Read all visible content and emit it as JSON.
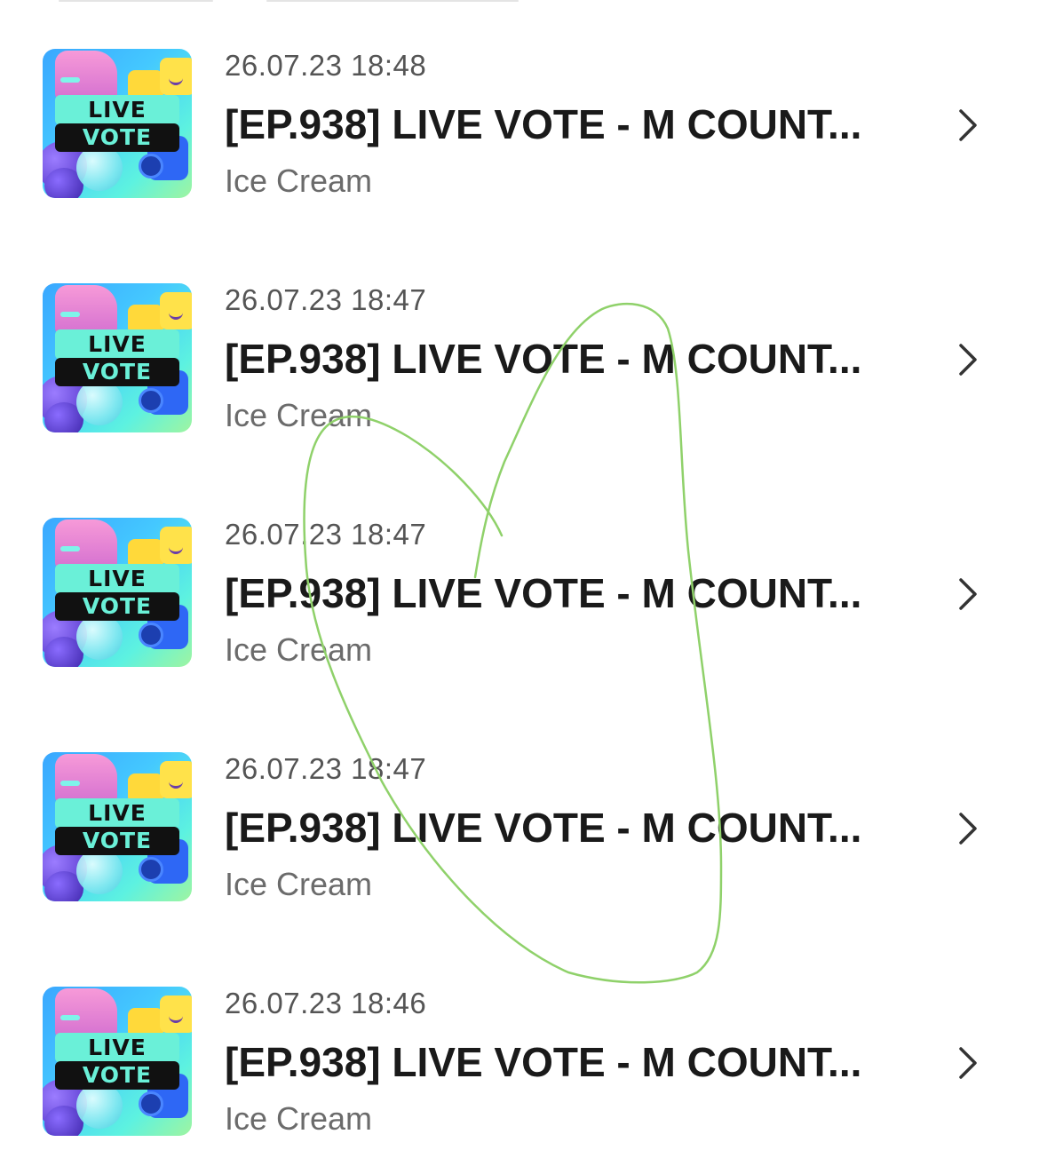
{
  "items": [
    {
      "timestamp": "26.07.23 18:48",
      "title": "[EP.938] LIVE VOTE - M COUNT...",
      "artist": "Ice Cream",
      "thumb_top": "LIVE",
      "thumb_bottom": "VOTE"
    },
    {
      "timestamp": "26.07.23 18:47",
      "title": "[EP.938] LIVE VOTE - M COUNT...",
      "artist": "Ice Cream",
      "thumb_top": "LIVE",
      "thumb_bottom": "VOTE"
    },
    {
      "timestamp": "26.07.23 18:47",
      "title": "[EP.938] LIVE VOTE - M COUNT...",
      "artist": "Ice Cream",
      "thumb_top": "LIVE",
      "thumb_bottom": "VOTE"
    },
    {
      "timestamp": "26.07.23 18:47",
      "title": "[EP.938] LIVE VOTE - M COUNT...",
      "artist": "Ice Cream",
      "thumb_top": "LIVE",
      "thumb_bottom": "VOTE"
    },
    {
      "timestamp": "26.07.23 18:46",
      "title": "[EP.938] LIVE VOTE - M COUNT...",
      "artist": "Ice Cream",
      "thumb_top": "LIVE",
      "thumb_bottom": "VOTE"
    }
  ],
  "chevron_icon": "chevron-right-icon",
  "annotation": {
    "shape": "heart",
    "color": "#8fd16a"
  },
  "colors": {
    "title": "#1a1a1a",
    "timestamp": "#555555",
    "artist": "#6b6b6b",
    "chevron": "#333333"
  }
}
